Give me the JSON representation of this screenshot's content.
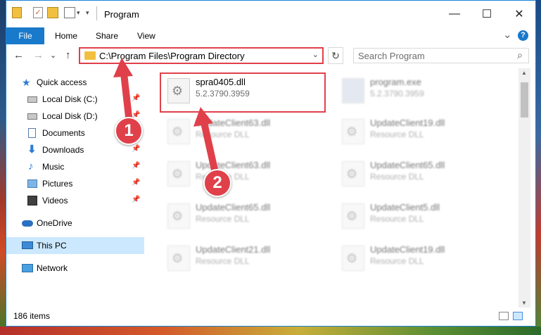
{
  "window": {
    "title": "Program",
    "controls": {
      "minimize": "—",
      "maximize": "☐",
      "close": "✕"
    }
  },
  "ribbon": {
    "tabs": [
      {
        "label": "File",
        "active": true
      },
      {
        "label": "Home"
      },
      {
        "label": "Share"
      },
      {
        "label": "View"
      }
    ],
    "help": "?",
    "collapse": "⌄"
  },
  "address": {
    "path": "C:\\Program Files\\Program Directory",
    "chevron": "⌄",
    "refresh": "↻"
  },
  "search": {
    "placeholder": "Search Program",
    "icon": "⌕"
  },
  "nav": {
    "back": "←",
    "forward": "→",
    "recent": "⌄",
    "up": "↑"
  },
  "sidebar": {
    "items": [
      {
        "label": "Quick access",
        "icon": "star-icon"
      },
      {
        "label": "Local Disk (C:)",
        "icon": "drive-icon",
        "pinned": true
      },
      {
        "label": "Local Disk (D:)",
        "icon": "drive-icon",
        "pinned": true
      },
      {
        "label": "Documents",
        "icon": "documents-icon",
        "pinned": true
      },
      {
        "label": "Downloads",
        "icon": "download-icon",
        "pinned": true
      },
      {
        "label": "Music",
        "icon": "music-icon",
        "pinned": true
      },
      {
        "label": "Pictures",
        "icon": "pictures-icon",
        "pinned": true
      },
      {
        "label": "Videos",
        "icon": "videos-icon",
        "pinned": true
      },
      {
        "label": "OneDrive",
        "icon": "cloud-icon"
      },
      {
        "label": "This PC",
        "icon": "computer-icon",
        "selected": true
      },
      {
        "label": "Network",
        "icon": "network-icon"
      }
    ],
    "pin_glyph": "📌"
  },
  "files": [
    {
      "name": "spra0405.dll",
      "desc": "5.2.3790.3959",
      "highlighted": true
    },
    {
      "name": "program.exe",
      "desc": "5.2.3790.3959"
    },
    {
      "name": "UpdateClient63.dll",
      "desc": "Resource DLL"
    },
    {
      "name": "UpdateClient19.dll",
      "desc": "Resource DLL"
    },
    {
      "name": "UpdateClient63.dll",
      "desc": "Resource DLL"
    },
    {
      "name": "UpdateClient65.dll",
      "desc": "Resource DLL"
    },
    {
      "name": "UpdateClient65.dll",
      "desc": "Resource DLL"
    },
    {
      "name": "UpdateClient5.dll",
      "desc": "Resource DLL"
    },
    {
      "name": "UpdateClient21.dll",
      "desc": "Resource DLL"
    },
    {
      "name": "UpdateClient19.dll",
      "desc": "Resource DLL"
    }
  ],
  "status": {
    "count": "186 items"
  },
  "annotations": {
    "step1": "1",
    "step2": "2"
  },
  "colors": {
    "accent": "#1979ca",
    "highlight": "#e0404a",
    "selected": "#cce8ff"
  }
}
